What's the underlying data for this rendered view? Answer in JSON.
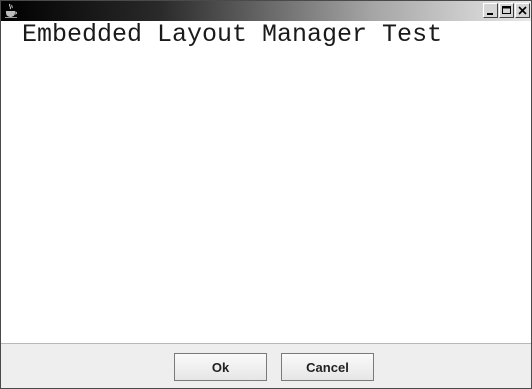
{
  "window": {
    "title": "",
    "app_icon": "java-cup-icon",
    "controls": {
      "minimize_icon": "minimize-icon",
      "maximize_icon": "maximize-icon",
      "close_icon": "close-icon"
    }
  },
  "main": {
    "heading": "Embedded Layout Manager Test"
  },
  "footer": {
    "ok_label": "Ok",
    "cancel_label": "Cancel"
  },
  "colors": {
    "titlebar_dark": "#000000",
    "titlebar_light": "#e8e8e8",
    "footer_bg": "#eeeeee",
    "content_bg": "#ffffff"
  }
}
